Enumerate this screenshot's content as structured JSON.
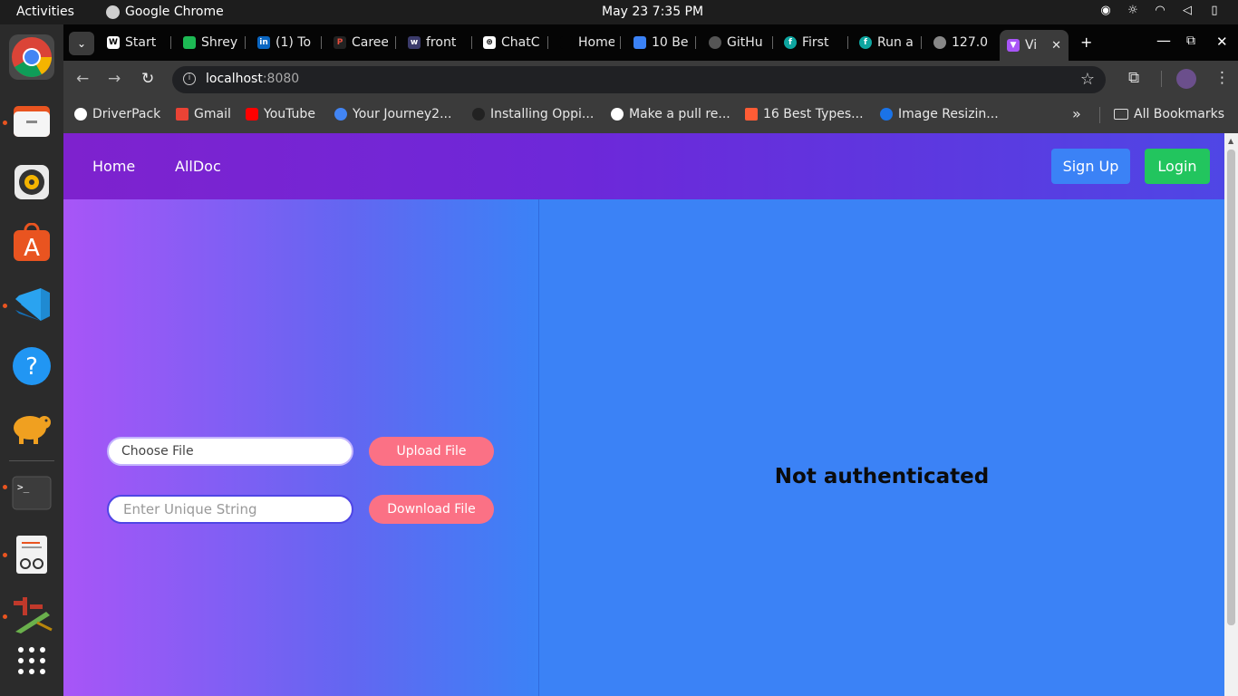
{
  "system": {
    "activities": "Activities",
    "app_name": "Google Chrome",
    "clock": "May 23  7:35 PM"
  },
  "dock": {
    "items": [
      "chrome-icon",
      "files-icon",
      "rhythmbox-icon",
      "app-center-icon",
      "vscode-icon",
      "help-icon",
      "postgres-icon",
      "terminal-icon",
      "text-editor-icon",
      "sqlpad-icon",
      "app-grid-icon"
    ]
  },
  "tabs": [
    {
      "label": "Start",
      "color": "#ffffff"
    },
    {
      "label": "Shrey",
      "color": "#1db954"
    },
    {
      "label": "(1) To",
      "color": "#0a66c2"
    },
    {
      "label": "Caree",
      "color": "#222222"
    },
    {
      "label": "front",
      "color": "#3b3b6b"
    },
    {
      "label": "ChatC",
      "color": "#ffffff"
    },
    {
      "label": "Home",
      "color": "#050505"
    },
    {
      "label": "10 Be",
      "color": "#3b82f6"
    },
    {
      "label": "GitHu",
      "color": "#555555"
    },
    {
      "label": "First",
      "color": "#0ea5a0"
    },
    {
      "label": "Run a",
      "color": "#0ea5a0"
    },
    {
      "label": "127.0",
      "color": "#888888"
    },
    {
      "label": "Vi",
      "color": "#a855f7"
    }
  ],
  "toolbar": {
    "url_host": "localhost",
    "url_port": ":8080"
  },
  "bookmarks": {
    "items": [
      {
        "label": "DriverPack",
        "color": "#ffffff"
      },
      {
        "label": "Gmail",
        "color": "#ea4335"
      },
      {
        "label": "YouTube",
        "color": "#ff0000"
      },
      {
        "label": "Your Journey2...",
        "color": "#4285f4"
      },
      {
        "label": "Installing Oppi...",
        "color": "#222222"
      },
      {
        "label": "Make a pull re...",
        "color": "#ffffff"
      },
      {
        "label": "16 Best Types...",
        "color": "#ff5c35"
      },
      {
        "label": "Image Resizin...",
        "color": "#1a73e8"
      }
    ],
    "overflow": "»",
    "all_bookmarks": "All Bookmarks"
  },
  "webapp": {
    "nav": {
      "home": "Home",
      "alldoc": "AllDoc",
      "signup": "Sign Up",
      "login": "Login"
    },
    "upload": {
      "choose_file": "Choose File",
      "upload_button": "Upload File"
    },
    "download": {
      "placeholder": "Enter Unique String",
      "download_button": "Download File"
    },
    "status": "Not authenticated",
    "colors": {
      "signup": "#3b82f6",
      "login": "#22c55e",
      "pill": "#fb7185"
    }
  }
}
